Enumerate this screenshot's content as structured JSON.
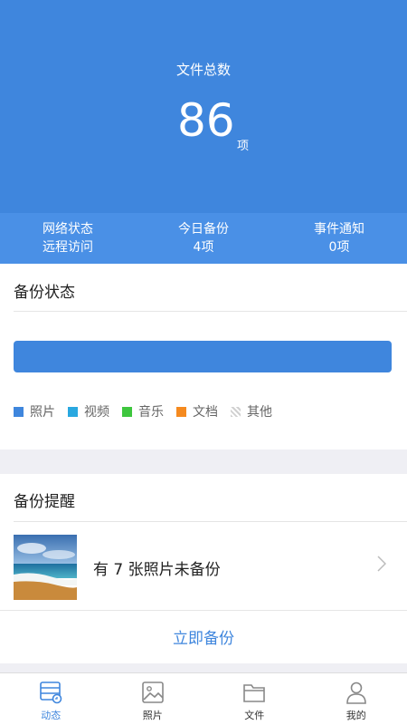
{
  "header": {
    "label": "文件总数",
    "count": "86",
    "unit": "项"
  },
  "stats": [
    {
      "title": "网络状态",
      "value": "远程访问"
    },
    {
      "title": "今日备份",
      "value": "4项"
    },
    {
      "title": "事件通知",
      "value": "0项"
    }
  ],
  "backup_status": {
    "title": "备份状态",
    "legend": [
      {
        "label": "照片",
        "color": "#3f86dd"
      },
      {
        "label": "视频",
        "color": "#29a8e0"
      },
      {
        "label": "音乐",
        "color": "#3ec63e"
      },
      {
        "label": "文档",
        "color": "#f58a1f"
      },
      {
        "label": "其他",
        "color": "#cccccc"
      }
    ]
  },
  "reminder": {
    "title": "备份提醒",
    "message": "有 7 张照片未备份",
    "action": "立即备份"
  },
  "tabbar": [
    {
      "label": "动态",
      "icon": "activity-icon",
      "active": true
    },
    {
      "label": "照片",
      "icon": "photo-icon",
      "active": false
    },
    {
      "label": "文件",
      "icon": "folder-icon",
      "active": false
    },
    {
      "label": "我的",
      "icon": "user-icon",
      "active": false
    }
  ],
  "colors": {
    "accent": "#3f86dd",
    "stats_bg": "#4a90e6"
  }
}
